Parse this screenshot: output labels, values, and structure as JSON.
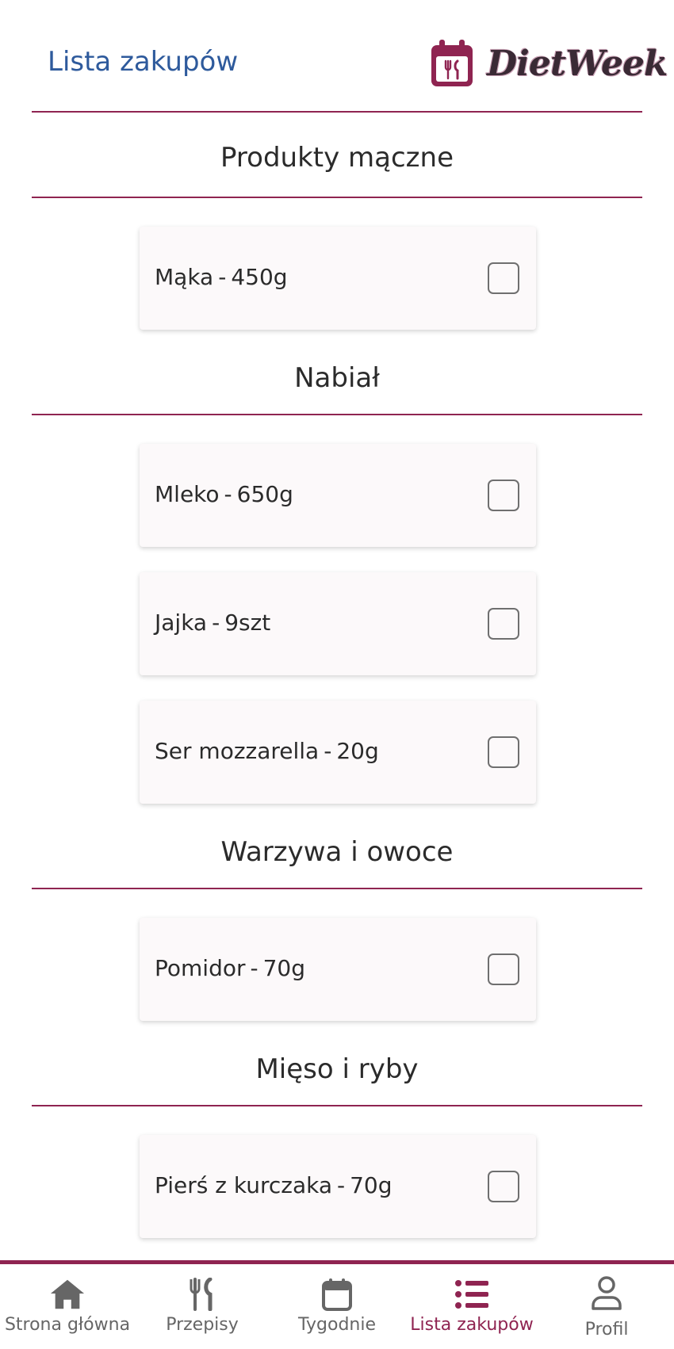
{
  "header": {
    "title": "Lista zakupów",
    "logo_text": "DietWeek"
  },
  "sections": [
    {
      "title": "Produkty mączne",
      "items": [
        {
          "name": "Mąka",
          "amount": "450g",
          "checked": false
        }
      ]
    },
    {
      "title": "Nabiał",
      "items": [
        {
          "name": "Mleko",
          "amount": "650g",
          "checked": false
        },
        {
          "name": "Jajka",
          "amount": "9szt",
          "checked": false
        },
        {
          "name": "Ser mozzarella",
          "amount": "20g",
          "checked": false
        }
      ]
    },
    {
      "title": "Warzywa i owoce",
      "items": [
        {
          "name": "Pomidor",
          "amount": "70g",
          "checked": false
        }
      ]
    },
    {
      "title": "Mięso i ryby",
      "items": [
        {
          "name": "Pierś z kurczaka",
          "amount": "70g",
          "checked": false
        }
      ]
    }
  ],
  "nav": {
    "items": [
      {
        "label": "Strona główna",
        "icon": "home-icon",
        "active": false
      },
      {
        "label": "Przepisy",
        "icon": "utensils-icon",
        "active": false
      },
      {
        "label": "Tygodnie",
        "icon": "calendar-icon",
        "active": false
      },
      {
        "label": "Lista zakupów",
        "icon": "list-icon",
        "active": true
      },
      {
        "label": "Profil",
        "icon": "user-icon",
        "active": false
      }
    ]
  },
  "colors": {
    "accent": "#8f2451",
    "title_blue": "#2e5a9c",
    "text": "#2b2b2b",
    "nav_inactive": "#666666"
  }
}
